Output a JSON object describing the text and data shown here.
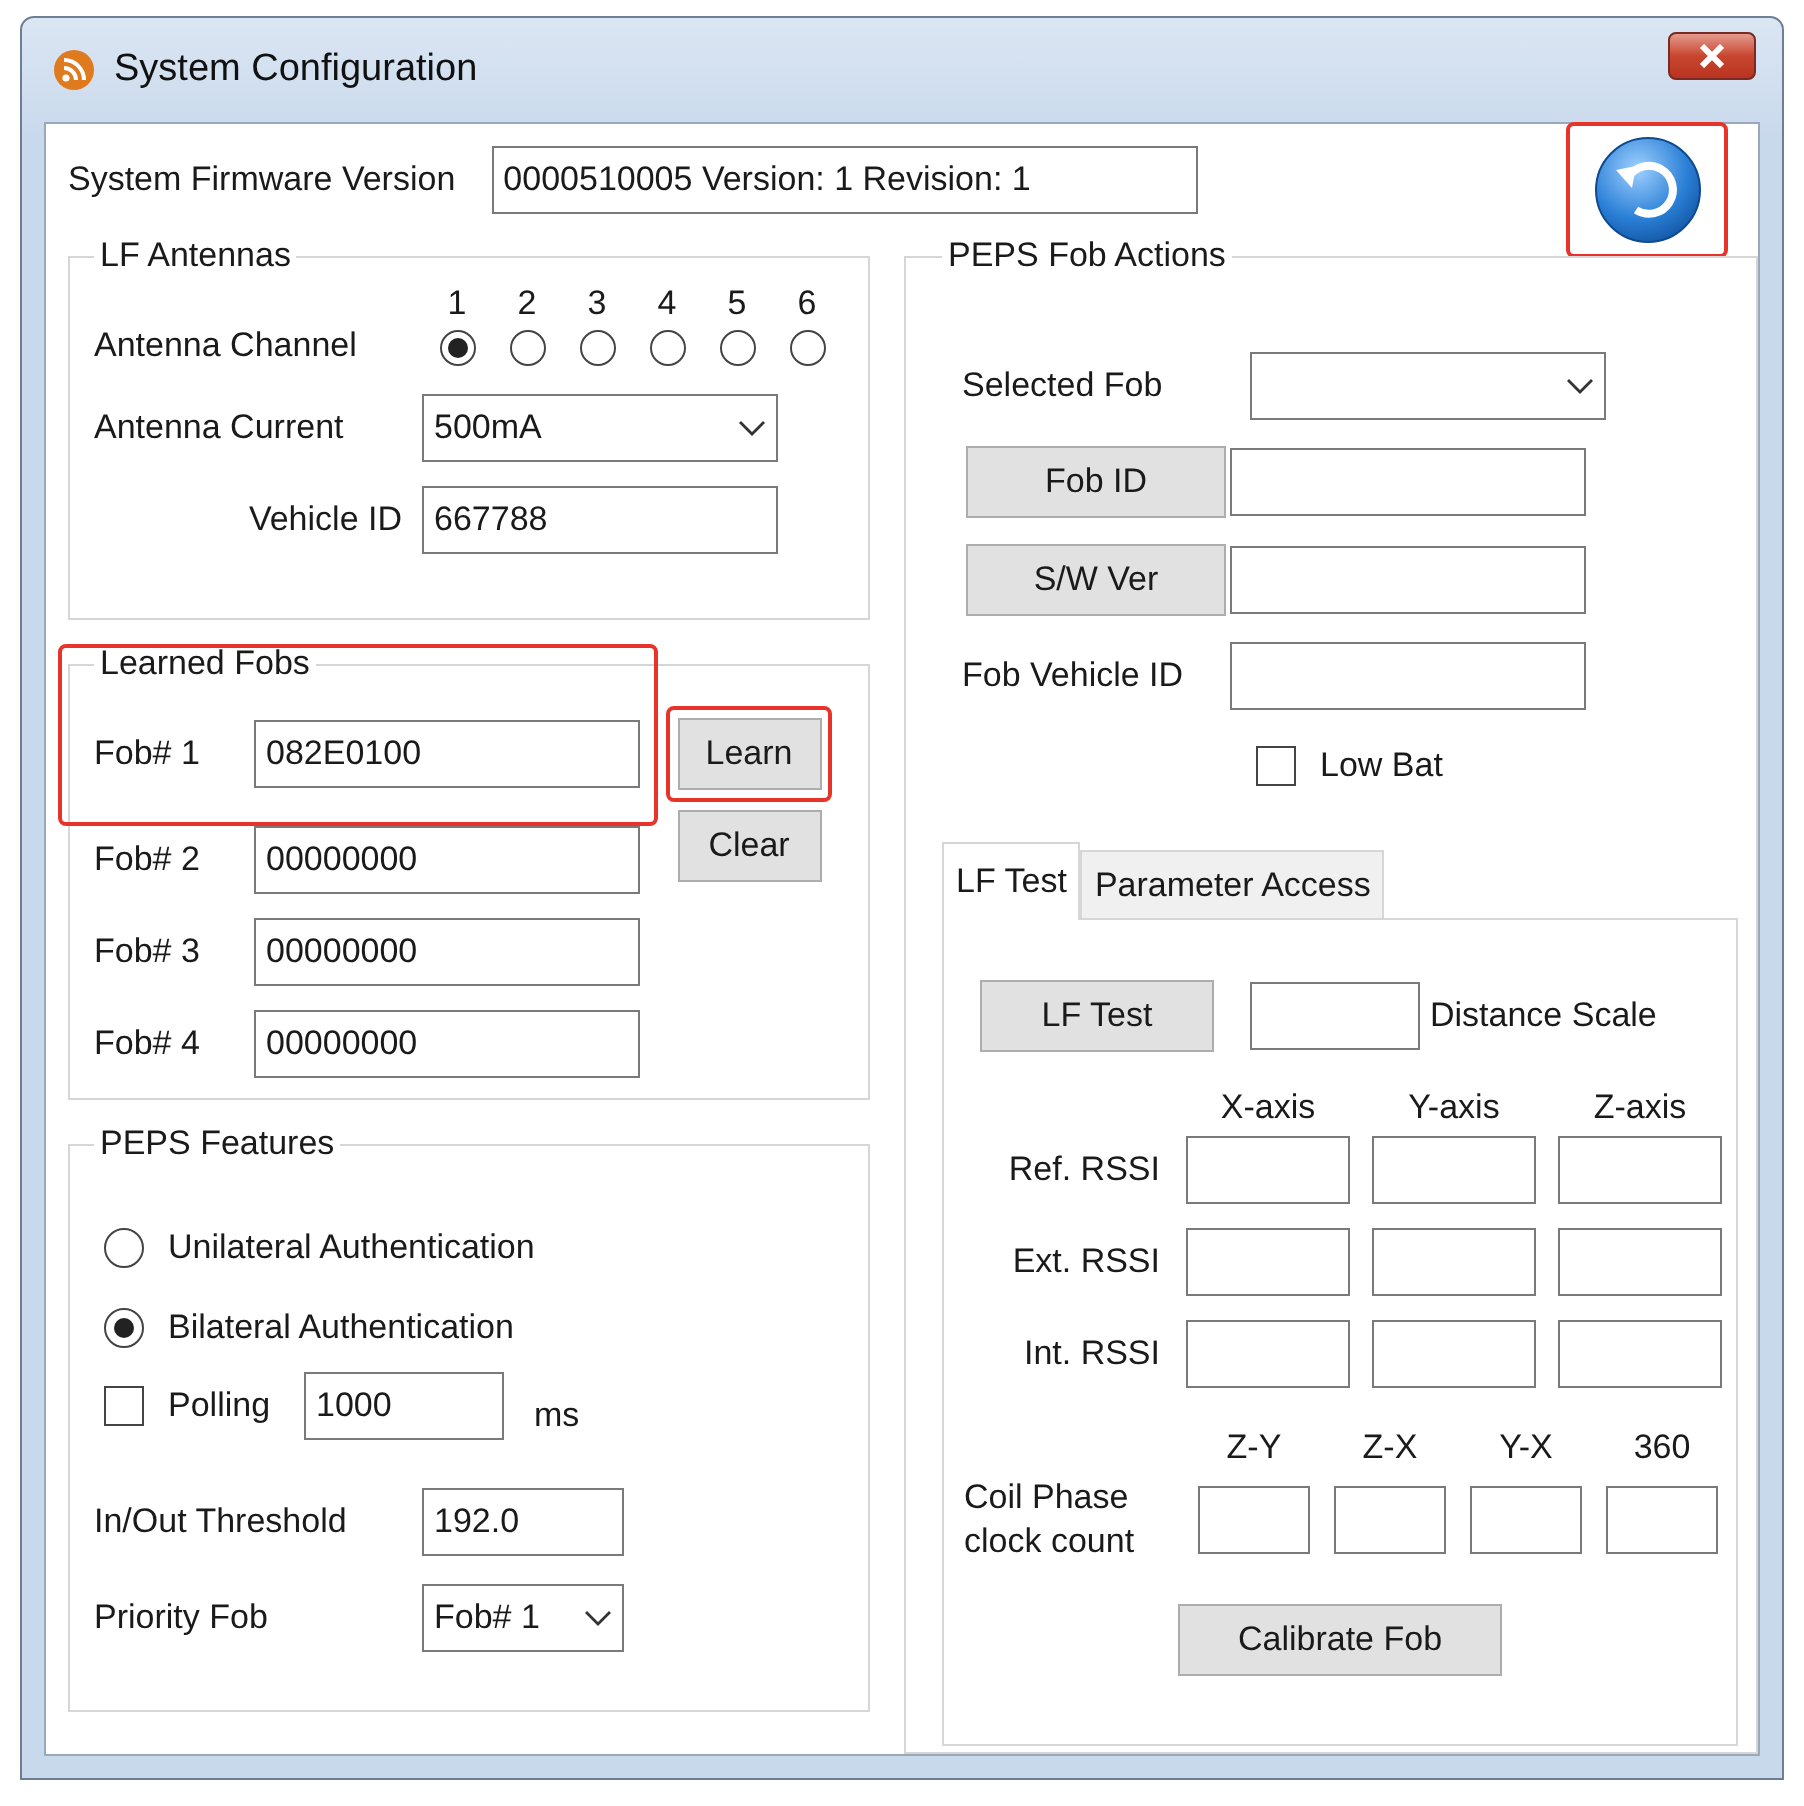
{
  "window": {
    "title": "System Configuration"
  },
  "firmware": {
    "label": "System Firmware Version",
    "value": "0000510005 Version: 1 Revision: 1"
  },
  "refresh_button": {
    "highlighted": true
  },
  "lf_antennas": {
    "title": "LF Antennas",
    "channel_label": "Antenna Channel",
    "channels": [
      {
        "label": "1",
        "selected": true
      },
      {
        "label": "2",
        "selected": false
      },
      {
        "label": "3",
        "selected": false
      },
      {
        "label": "4",
        "selected": false
      },
      {
        "label": "5",
        "selected": false
      },
      {
        "label": "6",
        "selected": false
      }
    ],
    "current": {
      "label": "Antenna Current",
      "value": "500mA"
    },
    "vehicle_id": {
      "label": "Vehicle ID",
      "value": "667788"
    }
  },
  "learned_fobs": {
    "title": "Learned Fobs",
    "highlighted": true,
    "fobs": [
      {
        "label": "Fob# 1",
        "value": "082E0100"
      },
      {
        "label": "Fob# 2",
        "value": "00000000"
      },
      {
        "label": "Fob# 3",
        "value": "00000000"
      },
      {
        "label": "Fob# 4",
        "value": "00000000"
      }
    ],
    "buttons": [
      {
        "label": "Learn",
        "highlighted": true
      },
      {
        "label": "Clear",
        "highlighted": false
      }
    ]
  },
  "peps_features": {
    "title": "PEPS Features",
    "auth_options": [
      {
        "label": "Unilateral Authentication",
        "selected": false
      },
      {
        "label": "Bilateral Authentication",
        "selected": true
      }
    ],
    "polling": {
      "label": "Polling",
      "checked": false,
      "value": "1000",
      "unit": "ms"
    },
    "threshold": {
      "label": "In/Out Threshold",
      "value": "192.0"
    },
    "priority_fob": {
      "label": "Priority Fob",
      "value": "Fob# 1"
    }
  },
  "fob_actions": {
    "title": "PEPS Fob Actions",
    "selected_fob": {
      "label": "Selected Fob"
    },
    "rows": [
      {
        "kind": "button",
        "label": "Fob ID"
      },
      {
        "kind": "button",
        "label": "S/W Ver"
      },
      {
        "kind": "label",
        "label": "Fob Vehicle ID"
      }
    ],
    "low_bat": {
      "label": "Low Bat",
      "checked": false
    },
    "tabs": [
      {
        "label": "LF Test",
        "selected": true
      },
      {
        "label": "Parameter Access",
        "selected": false
      }
    ],
    "lf_test": {
      "test_button": "LF Test",
      "distance_label": "Distance Scale",
      "axes": [
        "X-axis",
        "Y-axis",
        "Z-axis"
      ],
      "rssi_rows": [
        "Ref. RSSI",
        "Ext. RSSI",
        "Int. RSSI"
      ],
      "phase_columns": [
        "Z-Y",
        "Z-X",
        "Y-X",
        "360"
      ],
      "phase_label": "Coil Phase clock count",
      "calibrate_button": "Calibrate Fob"
    }
  }
}
